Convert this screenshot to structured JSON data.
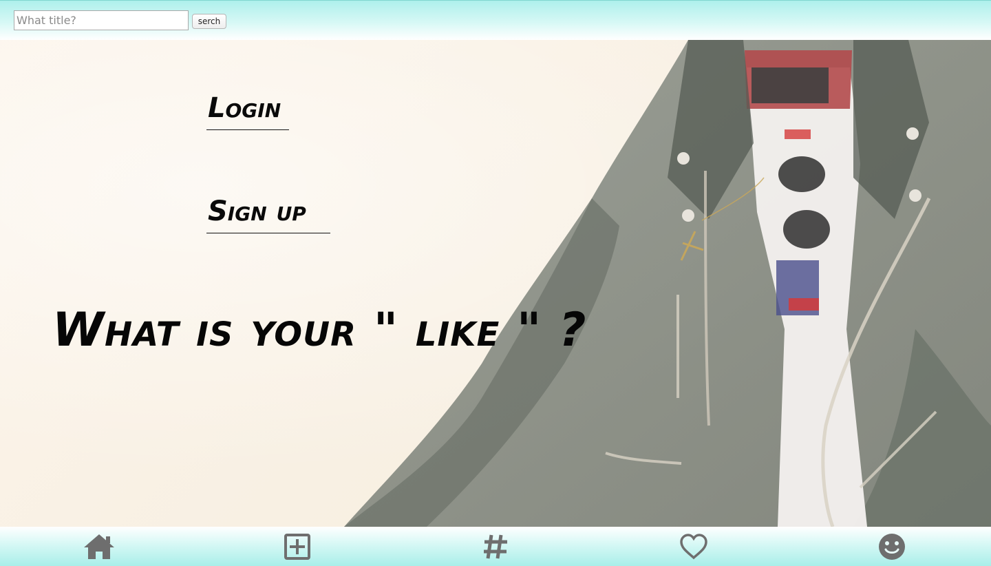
{
  "search": {
    "placeholder": "What title?",
    "value": "",
    "button_label": "serch"
  },
  "hero": {
    "login_label": "Login",
    "signup_label": "Sign up",
    "tagline": "What is your \" like \" ?"
  },
  "tab_bar": {
    "items": [
      {
        "name": "home",
        "icon": "home-icon"
      },
      {
        "name": "add-post",
        "icon": "plus-square-icon"
      },
      {
        "name": "tags",
        "icon": "hashtag-icon"
      },
      {
        "name": "likes",
        "icon": "heart-icon"
      },
      {
        "name": "profile",
        "icon": "smiley-icon"
      }
    ],
    "icon_color": "#6e6e6e"
  },
  "colors": {
    "bar_accent": "#aef0ec",
    "text": "#0a0a0a"
  }
}
